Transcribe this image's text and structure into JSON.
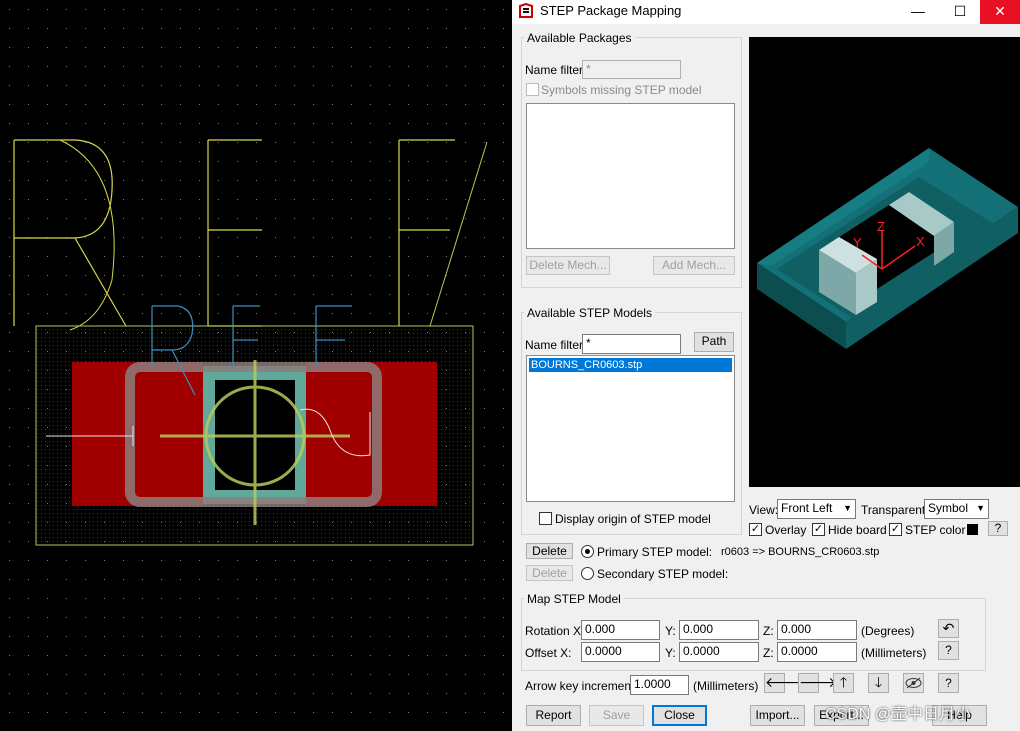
{
  "window": {
    "title": "STEP Package Mapping",
    "minimize": "—",
    "maximize": "☐",
    "close": "✕"
  },
  "available_packages": {
    "group_title": "Available Packages",
    "name_filter_label": "Name filter:",
    "name_filter_value": "*",
    "missing_label": "Symbols missing STEP model",
    "delete_mech": "Delete Mech...",
    "add_mech": "Add Mech..."
  },
  "available_models": {
    "group_title": "Available STEP Models",
    "name_filter_label": "Name filter:",
    "name_filter_value": "*",
    "path_button": "Path",
    "items": [
      "BOURNS_CR0603.stp"
    ],
    "display_origin_label": "Display origin of STEP model"
  },
  "viewer_options": {
    "view_label": "View:",
    "view_value": "Front Left",
    "transparent_label": "Transparent:",
    "transparent_value": "Symbol",
    "overlay_label": "Overlay",
    "hide_board_label": "Hide board",
    "step_color_label": "STEP color",
    "help_q": "?",
    "axis_x": "X",
    "axis_y": "Y",
    "axis_z": "Z",
    "colors": {
      "board": "#0f5f63",
      "board_top": "#137076",
      "terminal": "#7ea8a8",
      "body": "#000000",
      "axes": "#ff2020"
    }
  },
  "mapping": {
    "delete_primary": "Delete",
    "delete_secondary": "Delete",
    "primary_label": "Primary STEP model:",
    "primary_value": "r0603 => BOURNS_CR0603.stp",
    "secondary_label": "Secondary STEP model:"
  },
  "map_step_model": {
    "group_title": "Map STEP Model",
    "rotation_label": "Rotation X:",
    "offset_label": "Offset X:",
    "y_label": "Y:",
    "z_label": "Z:",
    "rotation": {
      "x": "0.000",
      "y": "0.000",
      "z": "0.000",
      "unit": "(Degrees)"
    },
    "offset": {
      "x": "0.0000",
      "y": "0.0000",
      "z": "0.0000",
      "unit": "(Millimeters)"
    },
    "rotate_icon": "↶",
    "help_q": "?"
  },
  "arrow_key": {
    "label": "Arrow key increment:",
    "value": "1.0000",
    "unit": "(Millimeters)",
    "left": "🡐",
    "right": "🡒",
    "up": "🡑",
    "down": "🡓",
    "help_q": "?"
  },
  "bottom_buttons": {
    "report": "Report",
    "save": "Save",
    "close": "Close",
    "import": "Import...",
    "export": "Export...",
    "help": "Help"
  },
  "watermark": "CSDN @壶中日月小",
  "pcb_colors": {
    "pad": "#a00000",
    "silk_yellow": "#d8d84a",
    "ref_blue": "#3b8fc0",
    "outline": "#b5c95a"
  }
}
